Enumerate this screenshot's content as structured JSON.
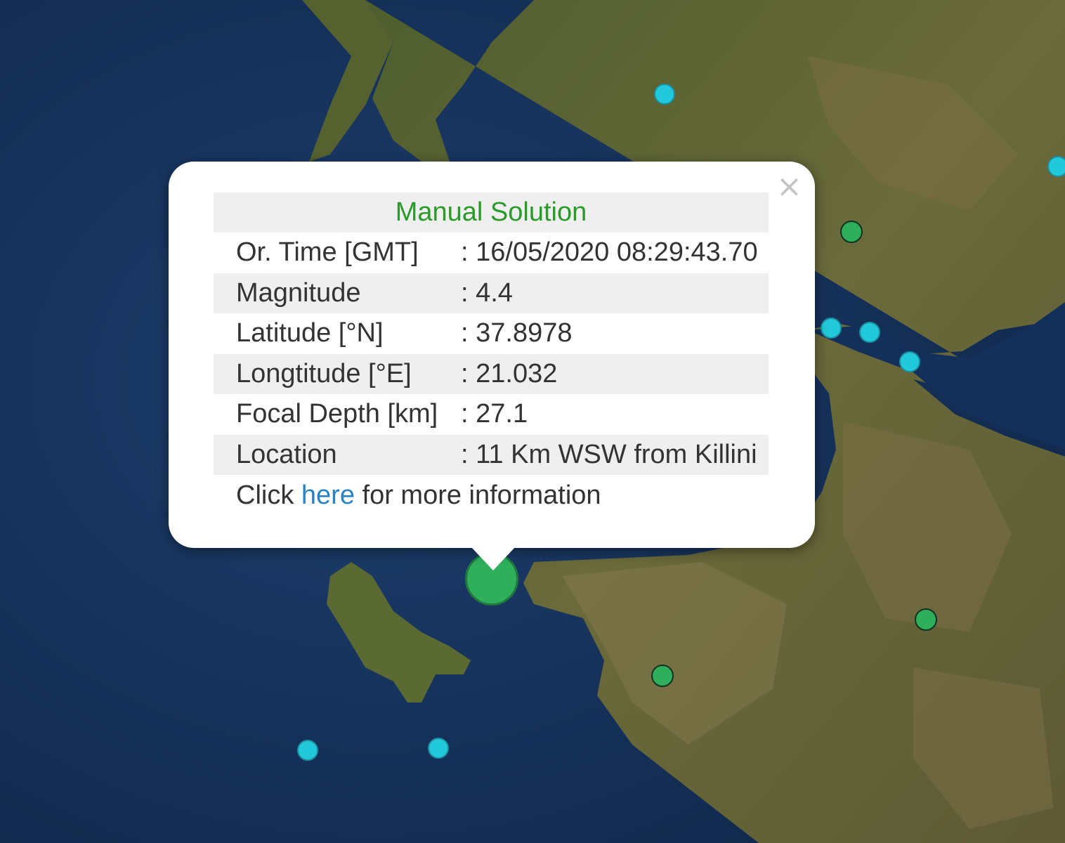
{
  "popup": {
    "title": "Manual Solution",
    "close_glyph": "×",
    "rows": [
      {
        "label": "Or. Time [GMT]",
        "value": ": 16/05/2020 08:29:43.70"
      },
      {
        "label": "Magnitude",
        "value": ": 4.4"
      },
      {
        "label": "Latitude [°N]",
        "value": ": 37.8978"
      },
      {
        "label": "Longtitude [°E]",
        "value": ": 21.032"
      },
      {
        "label": "Focal Depth [km]",
        "value": ": 27.1"
      },
      {
        "label": "Location",
        "value": ": 11 Km WSW from Killini"
      }
    ],
    "footer": {
      "prefix": "Click ",
      "link": "here",
      "suffix": " for more information"
    }
  },
  "colors": {
    "title": "#2a9a2a",
    "link": "#2a82c0",
    "marker_cyan": "#22c9da",
    "marker_green": "#2fae5c"
  },
  "icons": [
    "close-icon"
  ]
}
